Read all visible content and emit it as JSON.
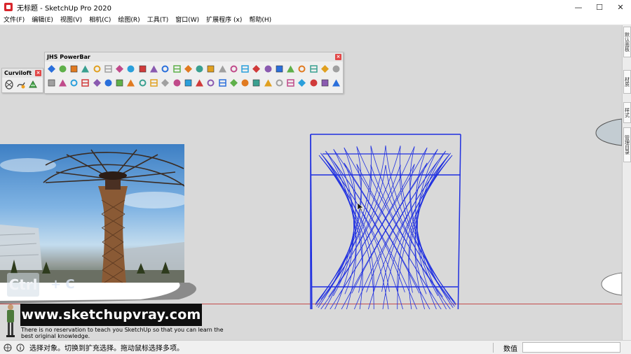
{
  "window": {
    "title": "无标题 - SketchUp Pro 2020",
    "minimize_glyph": "—",
    "maximize_glyph": "☐",
    "close_glyph": "✕"
  },
  "menu": {
    "items": [
      "文件(F)",
      "编辑(E)",
      "视图(V)",
      "相机(C)",
      "绘图(R)",
      "工具(T)",
      "窗口(W)",
      "扩展程序 (x)",
      "帮助(H)"
    ]
  },
  "curviloft": {
    "title": "Curviloft",
    "close_glyph": "×",
    "icons": [
      "curviloft-loft-icon",
      "curviloft-spline-icon",
      "curviloft-skin-icon"
    ]
  },
  "powerbar": {
    "title": "JHS PowerBar",
    "close_glyph": "×",
    "row1_count": 26,
    "row2_count": 26
  },
  "right_dock": {
    "tabs": [
      "默认面板",
      "材质",
      "样式",
      "管理目录"
    ]
  },
  "watermark": {
    "ctrl": "Ctrl",
    "plus": "+ C"
  },
  "banner": {
    "url": "www.sketchupvray.com",
    "tagline": "There is no reservation to teach you SketchUp so that you can learn the best original knowledge."
  },
  "status": {
    "message": "选择对象。切换到扩充选择。拖动鼠标选择多项。",
    "measure_label": "数值",
    "measure_value": ""
  },
  "colors": {
    "wire_blue": "#1f2fe0",
    "canvas_gray": "#d9d9d9",
    "axis_red": "#c44b4b"
  }
}
